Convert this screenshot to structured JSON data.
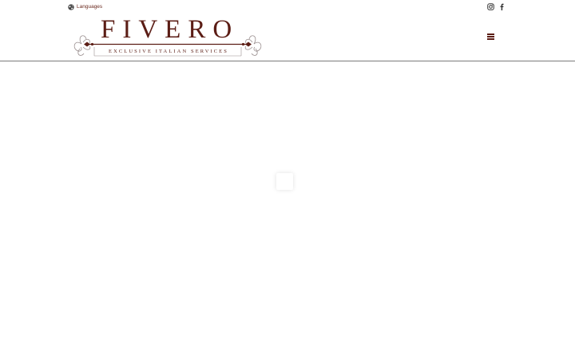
{
  "header": {
    "languages_label": "Languages",
    "logo": {
      "title": "FIVERO",
      "subtitle": "EXCLUSIVE ITALIAN SERVICES"
    },
    "social": [
      {
        "name": "instagram-icon"
      },
      {
        "name": "facebook-icon"
      }
    ],
    "menu_icon": "hamburger-menu-icon"
  },
  "colors": {
    "brand": "#5b1d15",
    "link": "#6b2a1f",
    "divider": "#7a7a7a"
  }
}
